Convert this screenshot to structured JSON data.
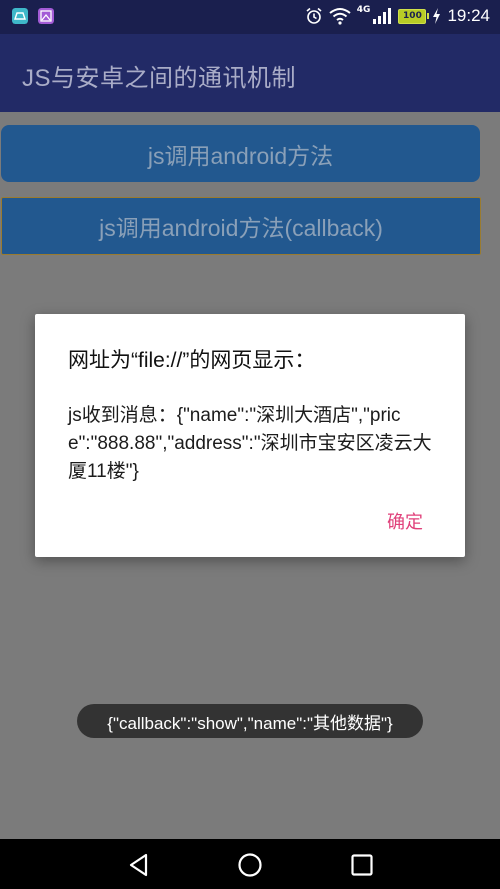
{
  "status_bar": {
    "icons_left": [
      "app-notification-icon",
      "gallery-notification-icon"
    ],
    "network_label": "4G",
    "battery_level": "100",
    "time": "19:24",
    "colors": {
      "background": "#1a1f4e",
      "battery": "#b8cc26"
    }
  },
  "app_bar": {
    "title": "JS与安卓之间的通讯机制",
    "color": "#222a66"
  },
  "buttons": {
    "call_android": "js调用android方法",
    "call_android_callback": "js调用android方法(callback)"
  },
  "dialog": {
    "title": "网址为“file://”的网页显示：",
    "message": "js收到消息：{\"name\":\"深圳大酒店\",\"price\":\"888.88\",\"address\":\"深圳市宝安区凌云大厦11楼\"}",
    "ok_label": "确定",
    "accent": "#e0407a"
  },
  "toast": {
    "text": "{\"callback\":\"show\",\"name\":\"其他数据\"}"
  },
  "nav_bar": {
    "icons": [
      "back-icon",
      "home-icon",
      "recents-icon"
    ]
  }
}
